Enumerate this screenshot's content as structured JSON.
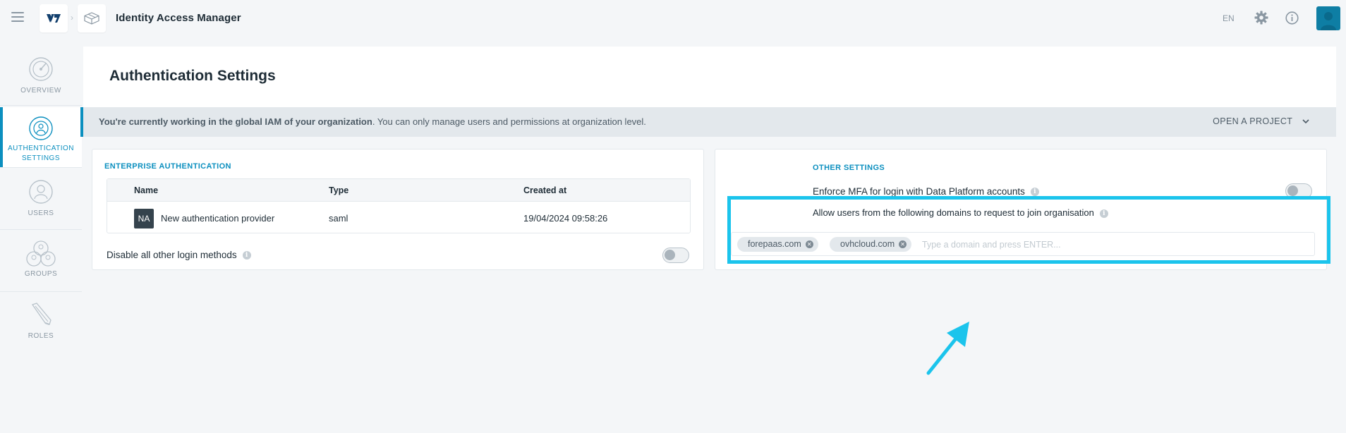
{
  "topbar": {
    "app_title": "Identity Access Manager",
    "language": "EN",
    "breadcrumb_separator": "›"
  },
  "sidebar": {
    "items": [
      {
        "label_lines": [
          "OVERVIEW"
        ],
        "icon": "overview-icon"
      },
      {
        "label_lines": [
          "AUTHENTICATION",
          "SETTINGS"
        ],
        "icon": "authentication-icon",
        "active": true
      },
      {
        "label_lines": [
          "USERS"
        ],
        "icon": "users-icon"
      },
      {
        "label_lines": [
          "GROUPS"
        ],
        "icon": "groups-icon"
      },
      {
        "label_lines": [
          "ROLES"
        ],
        "icon": "roles-icon"
      }
    ]
  },
  "page": {
    "title": "Authentication Settings"
  },
  "banner": {
    "bold_text": "You're currently working in the global IAM of your organization",
    "text": ". You can only manage users and permissions at organization level.",
    "open_project_label": "OPEN A PROJECT"
  },
  "enterprise_auth": {
    "heading": "ENTERPRISE AUTHENTICATION",
    "columns": [
      "Name",
      "Type",
      "Created at"
    ],
    "rows": [
      {
        "badge": "NA",
        "name": "New authentication provider",
        "type": "saml",
        "created_at": "19/04/2024 09:58:26"
      }
    ],
    "disable_label": "Disable all other login methods",
    "disable_enabled": false
  },
  "other_settings": {
    "heading": "OTHER SETTINGS",
    "mfa_label": "Enforce MFA for login with Data Platform accounts",
    "mfa_enabled": false,
    "domains_label": "Allow users from the following domains to request to join organisation",
    "domains": [
      "forepaas.com",
      "ovhcloud.com"
    ],
    "domain_placeholder": "Type a domain and press ENTER..."
  },
  "colors": {
    "accent": "#0b8fbf",
    "highlight": "#1bc4ec",
    "avatar": "#0e7ea4"
  }
}
